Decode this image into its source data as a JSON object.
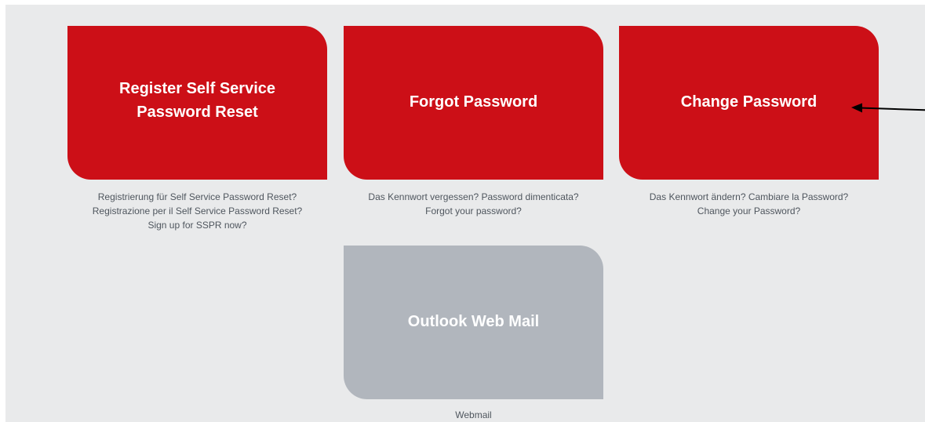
{
  "tiles": [
    {
      "title_lines": [
        "Register Self Service",
        "Password Reset"
      ],
      "caption_lines": [
        "Registrierung für Self Service Password Reset?",
        "Registrazione per il Self Service Password Reset?",
        "Sign up for SSPR now?"
      ]
    },
    {
      "title_lines": [
        "Forgot Password"
      ],
      "caption_lines": [
        "Das Kennwort vergessen? Password dimenticata?",
        "Forgot your password?"
      ]
    },
    {
      "title_lines": [
        "Change Password"
      ],
      "caption_lines": [
        "Das Kennwort ändern? Cambiare la Password?",
        "Change your Password?"
      ]
    },
    {
      "title_lines": [
        "Outlook Web Mail"
      ],
      "caption_lines": [
        "Webmail"
      ]
    }
  ],
  "colors": {
    "tile_active": "#cc0f17",
    "tile_inactive": "#b1b6bd",
    "background": "#e9eaeb",
    "caption_text": "#4f565e"
  },
  "annotation": {
    "icon": "arrow-left-icon",
    "points_to": "Change Password"
  }
}
